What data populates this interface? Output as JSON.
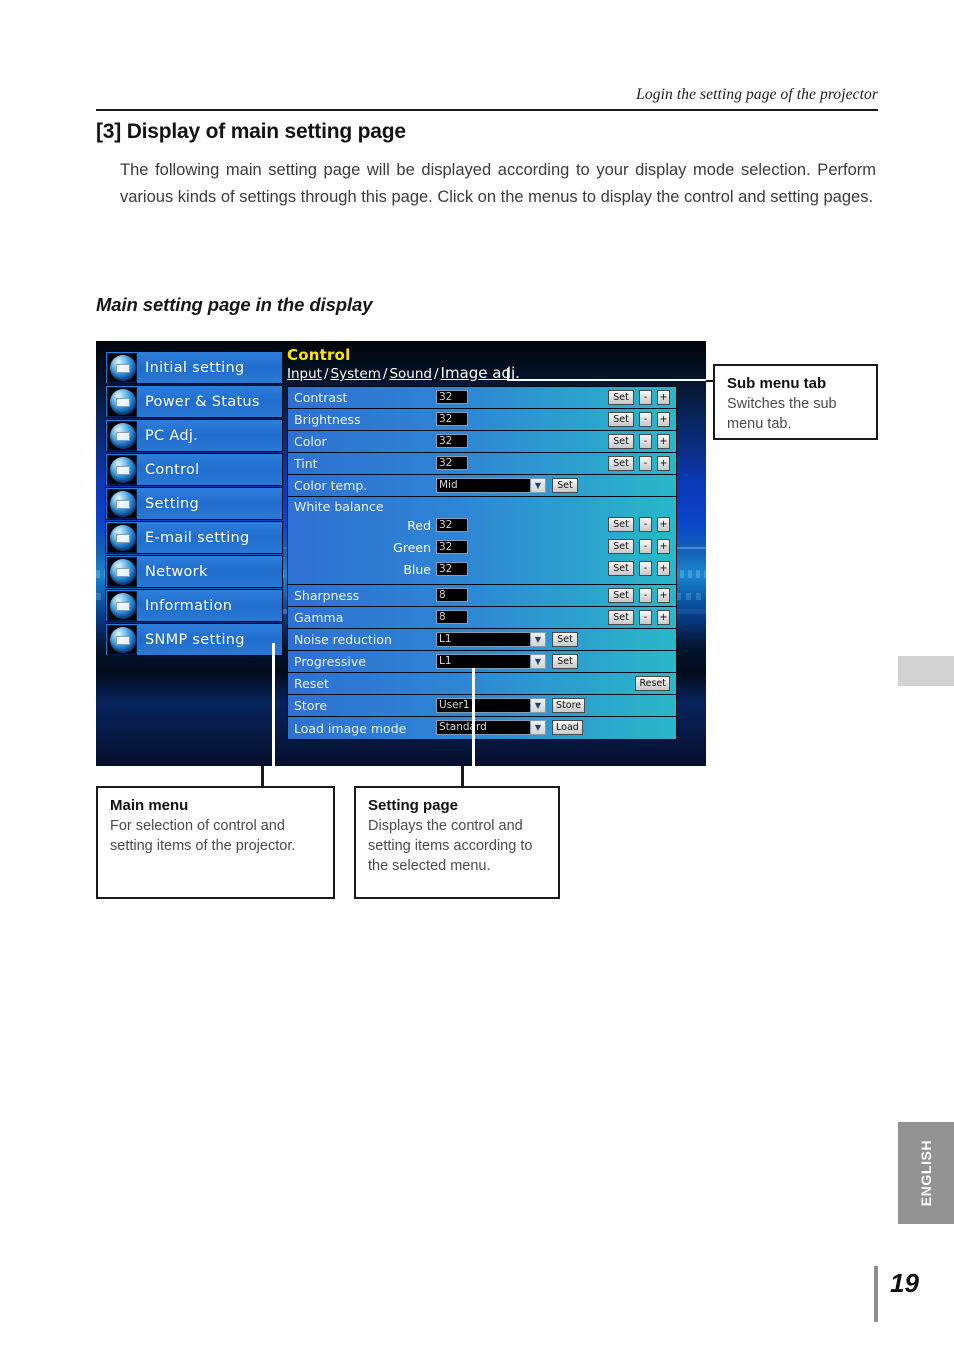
{
  "page": {
    "running_head": "Login the setting page of the projector",
    "folio": "19",
    "language_tab": "ENGLISH"
  },
  "section": {
    "number": "[3]",
    "title": "Display of main setting page",
    "heading_full": "[3] Display of main setting page",
    "intro": "The following main setting page will be displayed according to your display mode selection. Perform various kinds of settings through this page. Click on the menus to display the control and setting pages.",
    "subsection": "Main setting page in the display"
  },
  "screenshot": {
    "main_menu": [
      {
        "label": "Initial setting",
        "icon": "initial-setting-icon"
      },
      {
        "label": "Power & Status",
        "icon": "power-status-icon"
      },
      {
        "label": "PC Adj.",
        "icon": "pc-adj-icon"
      },
      {
        "label": "Control",
        "icon": "control-icon"
      },
      {
        "label": "Setting",
        "icon": "setting-icon"
      },
      {
        "label": "E-mail setting",
        "icon": "email-setting-icon"
      },
      {
        "label": "Network",
        "icon": "network-icon"
      },
      {
        "label": "Information",
        "icon": "information-icon"
      },
      {
        "label": "SNMP setting",
        "icon": "snmp-setting-icon"
      }
    ],
    "panel": {
      "title": "Control",
      "tabs": [
        {
          "label": "Input",
          "active": false
        },
        {
          "label": "System",
          "active": false
        },
        {
          "label": "Sound",
          "active": false
        },
        {
          "label": "Image adj.",
          "active": true
        }
      ],
      "tab_separator": "/",
      "rows": [
        {
          "label": "Contrast",
          "type": "value",
          "value": "32",
          "buttons": [
            "Set",
            "-",
            "+"
          ]
        },
        {
          "label": "Brightness",
          "type": "value",
          "value": "32",
          "buttons": [
            "Set",
            "-",
            "+"
          ]
        },
        {
          "label": "Color",
          "type": "value",
          "value": "32",
          "buttons": [
            "Set",
            "-",
            "+"
          ]
        },
        {
          "label": "Tint",
          "type": "value",
          "value": "32",
          "buttons": [
            "Set",
            "-",
            "+"
          ]
        },
        {
          "label": "Color temp.",
          "type": "select",
          "value": "Mid",
          "buttons": [
            "Set"
          ]
        },
        {
          "label": "Sharpness",
          "type": "value",
          "value": "8",
          "buttons": [
            "Set",
            "-",
            "+"
          ]
        },
        {
          "label": "Gamma",
          "type": "value",
          "value": "8",
          "buttons": [
            "Set",
            "-",
            "+"
          ]
        },
        {
          "label": "Noise reduction",
          "type": "select",
          "value": "L1",
          "buttons": [
            "Set"
          ]
        },
        {
          "label": "Progressive",
          "type": "select",
          "value": "L1",
          "buttons": [
            "Set"
          ]
        },
        {
          "label": "Reset",
          "type": "button",
          "value": "",
          "buttons": [
            "Reset"
          ]
        },
        {
          "label": "Store",
          "type": "select",
          "value": "User1",
          "buttons": [
            "Store"
          ]
        },
        {
          "label": "Load image mode",
          "type": "select",
          "value": "Standard",
          "buttons": [
            "Load"
          ]
        }
      ],
      "white_balance": {
        "label": "White balance",
        "channels": [
          {
            "name": "Red",
            "value": "32",
            "buttons": [
              "Set",
              "-",
              "+"
            ]
          },
          {
            "name": "Green",
            "value": "32",
            "buttons": [
              "Set",
              "-",
              "+"
            ]
          },
          {
            "name": "Blue",
            "value": "32",
            "buttons": [
              "Set",
              "-",
              "+"
            ]
          }
        ]
      }
    }
  },
  "callouts": {
    "sub_menu_tab": {
      "title": "Sub menu tab",
      "body": "Switches the sub menu tab."
    },
    "main_menu": {
      "title": "Main menu",
      "body": "For selection of  control and setting items of the projector."
    },
    "setting_page": {
      "title": "Setting page",
      "body": "Displays the control and setting items according to the selected menu."
    }
  }
}
